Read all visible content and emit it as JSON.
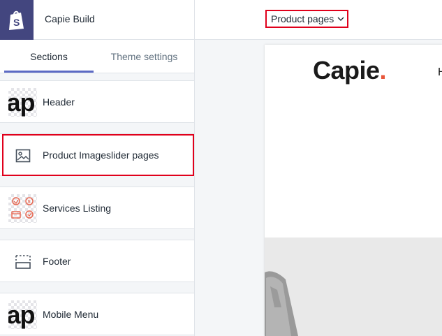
{
  "app": {
    "store_name": "Capie Build"
  },
  "tabs": [
    {
      "label": "Sections"
    },
    {
      "label": "Theme settings"
    }
  ],
  "sections": [
    {
      "label": "Header",
      "icon": "ap-thumbnail-icon"
    },
    {
      "label": "Product Imageslider pages",
      "icon": "image-icon"
    },
    {
      "label": "Services Listing",
      "icon": "services-thumbnail-icon"
    },
    {
      "label": "Footer",
      "icon": "footer-icon"
    },
    {
      "label": "Mobile Menu",
      "icon": "ap-thumbnail-icon"
    }
  ],
  "toolbar": {
    "page_select_value": "Product pages"
  },
  "preview": {
    "brand": "Capie",
    "brand_dot": ".",
    "nav_peek": "H"
  },
  "colors": {
    "accent": "#5c6ac4",
    "logo_bg": "#43467f",
    "highlight": "#e0001b",
    "brand_dot": "#e8563a"
  }
}
